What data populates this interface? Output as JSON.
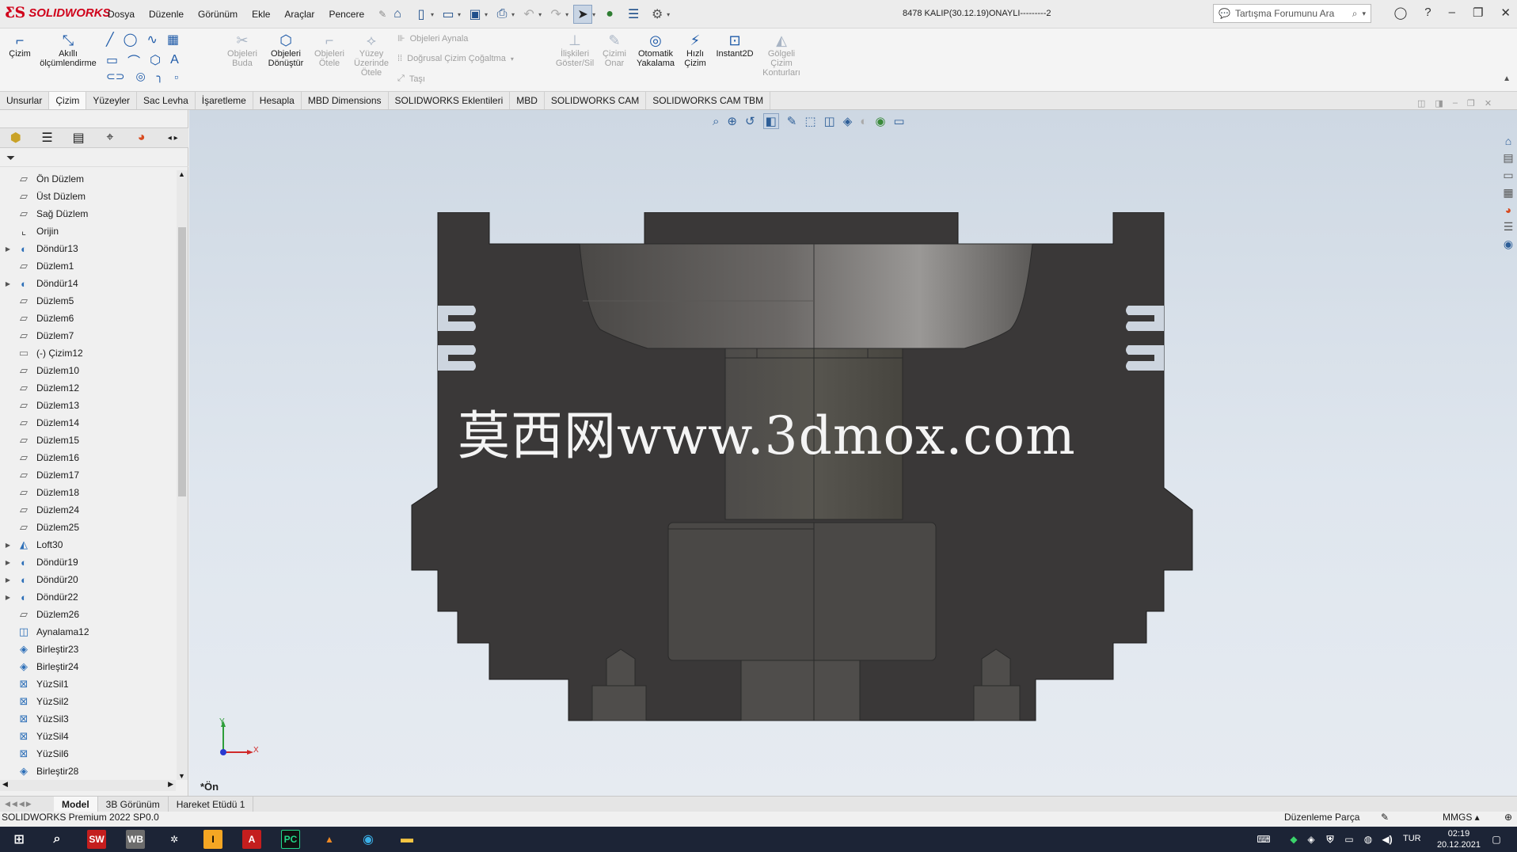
{
  "app": {
    "brand": "SOLIDWORKS",
    "document_title": "8478 KALIP(30.12.19)ONAYLI---------2",
    "menu": [
      "Dosya",
      "Düzenle",
      "Görünüm",
      "Ekle",
      "Araçlar",
      "Pencere"
    ],
    "search_placeholder": "Tartışma Forumunu Ara"
  },
  "ribbon": {
    "cizim": "Çizim",
    "akilli": "Akıllı ölçümlendirme",
    "objeleri_buda": "Objeleri Buda",
    "objeleri_donustur": "Objeleri Dönüştür",
    "objeleri_otele": "Objeleri Ötele",
    "yuzey_uzerinde_otele": "Yüzey Üzerinde Ötele",
    "objeleri_aynala": "Objeleri Aynala",
    "dogrusal_cizim_cogaltma": "Doğrusal Çizim Çoğaltma",
    "tasi": "Taşı",
    "iliskileri_goster_sil": "İlişkileri Göster/Sil",
    "cizimi_onar": "Çizimi Onar",
    "otomatik_yakalama": "Otomatik Yakalama",
    "hizli_cizim": "Hızlı Çizim",
    "instant2d": "Instant2D",
    "golgeli_cizim_konturlari": "Gölgeli Çizim Konturları"
  },
  "command_tabs": [
    "Unsurlar",
    "Çizim",
    "Yüzeyler",
    "Sac Levha",
    "İşaretleme",
    "Hesapla",
    "MBD Dimensions",
    "SOLIDWORKS Eklentileri",
    "MBD",
    "SOLIDWORKS CAM",
    "SOLIDWORKS CAM TBM"
  ],
  "active_tab": "Çizim",
  "feature_tree": [
    {
      "label": "Ön Düzlem",
      "icon": "plane",
      "expandable": false
    },
    {
      "label": "Üst Düzlem",
      "icon": "plane",
      "expandable": false
    },
    {
      "label": "Sağ Düzlem",
      "icon": "plane",
      "expandable": false
    },
    {
      "label": "Orijin",
      "icon": "origin",
      "expandable": false
    },
    {
      "label": "Döndür13",
      "icon": "revolve",
      "expandable": true
    },
    {
      "label": "Düzlem1",
      "icon": "plane",
      "expandable": false
    },
    {
      "label": "Döndür14",
      "icon": "revolve",
      "expandable": true
    },
    {
      "label": "Düzlem5",
      "icon": "plane",
      "expandable": false
    },
    {
      "label": "Düzlem6",
      "icon": "plane",
      "expandable": false
    },
    {
      "label": "Düzlem7",
      "icon": "plane",
      "expandable": false
    },
    {
      "label": "(-) Çizim12",
      "icon": "sketch",
      "expandable": false
    },
    {
      "label": "Düzlem10",
      "icon": "plane",
      "expandable": false
    },
    {
      "label": "Düzlem12",
      "icon": "plane",
      "expandable": false
    },
    {
      "label": "Düzlem13",
      "icon": "plane",
      "expandable": false
    },
    {
      "label": "Düzlem14",
      "icon": "plane",
      "expandable": false
    },
    {
      "label": "Düzlem15",
      "icon": "plane",
      "expandable": false
    },
    {
      "label": "Düzlem16",
      "icon": "plane",
      "expandable": false
    },
    {
      "label": "Düzlem17",
      "icon": "plane",
      "expandable": false
    },
    {
      "label": "Düzlem18",
      "icon": "plane",
      "expandable": false
    },
    {
      "label": "Düzlem24",
      "icon": "plane",
      "expandable": false
    },
    {
      "label": "Düzlem25",
      "icon": "plane",
      "expandable": false
    },
    {
      "label": "Loft30",
      "icon": "loft",
      "expandable": true
    },
    {
      "label": "Döndür19",
      "icon": "revolve",
      "expandable": true
    },
    {
      "label": "Döndür20",
      "icon": "revolve",
      "expandable": true
    },
    {
      "label": "Döndür22",
      "icon": "revolve",
      "expandable": true
    },
    {
      "label": "Düzlem26",
      "icon": "plane",
      "expandable": false
    },
    {
      "label": "Aynalama12",
      "icon": "mirror",
      "expandable": false
    },
    {
      "label": "Birleştir23",
      "icon": "combine",
      "expandable": false
    },
    {
      "label": "Birleştir24",
      "icon": "combine",
      "expandable": false
    },
    {
      "label": "YüzSil1",
      "icon": "deleteface",
      "expandable": false
    },
    {
      "label": "YüzSil2",
      "icon": "deleteface",
      "expandable": false
    },
    {
      "label": "YüzSil3",
      "icon": "deleteface",
      "expandable": false
    },
    {
      "label": "YüzSil4",
      "icon": "deleteface",
      "expandable": false
    },
    {
      "label": "YüzSil6",
      "icon": "deleteface",
      "expandable": false
    },
    {
      "label": "Birleştir28",
      "icon": "combine",
      "expandable": false
    }
  ],
  "viewport": {
    "watermark": "莫西网www.3dmox.com",
    "view_name": "*Ön",
    "triad_x": "X",
    "triad_y": "Y"
  },
  "bottom_tabs": [
    "Model",
    "3B Görünüm",
    "Hareket Etüdü 1"
  ],
  "status": {
    "version": "SOLIDWORKS Premium 2022 SP0.0",
    "mode": "Düzenleme Parça",
    "units": "MMGS"
  },
  "taskbar": {
    "lang": "TUR",
    "time": "02:19",
    "date": "20.12.2021"
  },
  "colors": {
    "brand_red": "#d0021b",
    "part_dark": "#3a3838",
    "viewport_top": "#ced8e3",
    "taskbar": "#1c2436"
  }
}
